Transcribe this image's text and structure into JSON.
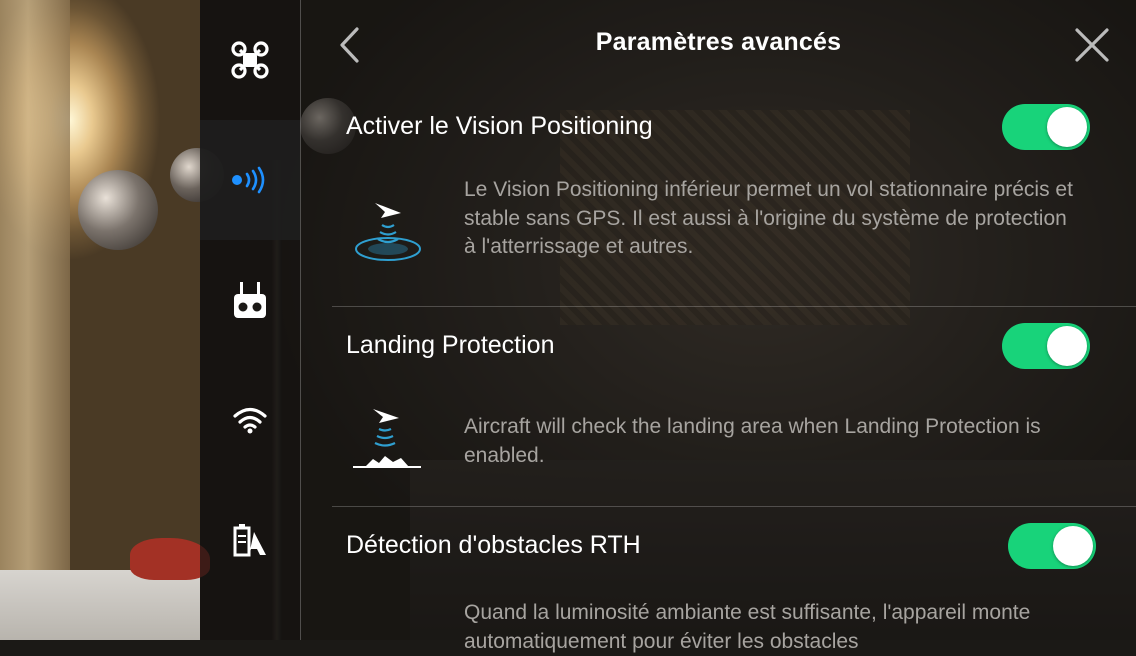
{
  "header": {
    "title": "Paramètres avancés",
    "back_icon": "chevron-left-icon",
    "close_icon": "close-icon"
  },
  "sidebar": {
    "items": [
      {
        "icon": "aircraft-icon",
        "active": false
      },
      {
        "icon": "vision-sensor-icon",
        "active": true
      },
      {
        "icon": "remote-controller-icon",
        "active": false
      },
      {
        "icon": "wifi-icon",
        "active": false
      },
      {
        "icon": "battery-icon",
        "active": false
      }
    ]
  },
  "settings": [
    {
      "title": "Activer le Vision Positioning",
      "enabled": true,
      "illustration": "vision-positioning-icon",
      "description": "Le Vision Positioning inférieur permet un vol stationnaire précis et stable sans GPS. Il est aussi à l'origine du système de protection à l'atterrissage et autres."
    },
    {
      "title": "Landing Protection",
      "enabled": true,
      "illustration": "landing-protection-icon",
      "description": "Aircraft will check the landing area when Landing Protection is enabled."
    },
    {
      "title": "Détection d'obstacles RTH",
      "enabled": true,
      "description": "Quand la luminosité ambiante est suffisante, l'appareil monte automatiquement pour éviter les obstacles"
    }
  ],
  "colors": {
    "accent_active_icon": "#1e90ff",
    "toggle_on": "#18d37a",
    "description_text": "#a7a4a0"
  }
}
